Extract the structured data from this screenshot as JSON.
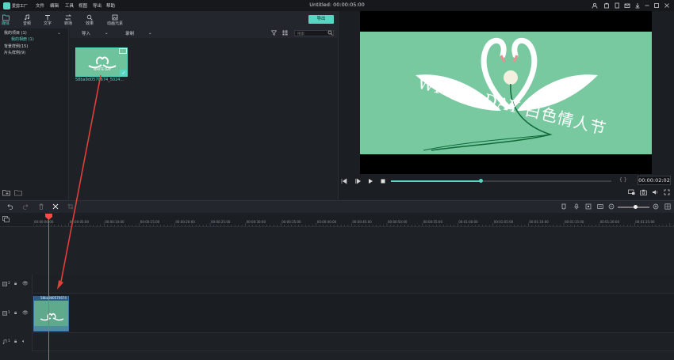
{
  "app": {
    "logo_text": "爱剪工厂",
    "title": "Untitled: 00:00:05:00"
  },
  "menu": [
    "文件",
    "编辑",
    "工具",
    "视图",
    "导出",
    "帮助"
  ],
  "tabs": [
    {
      "label": "媒体",
      "icon": "folder-icon"
    },
    {
      "label": "音频",
      "icon": "music-note-icon"
    },
    {
      "label": "文字",
      "icon": "text-icon"
    },
    {
      "label": "转场",
      "icon": "transition-icon"
    },
    {
      "label": "效果",
      "icon": "effects-icon"
    },
    {
      "label": "动画元素",
      "icon": "image-icon"
    }
  ],
  "export_label": "导出",
  "library": {
    "items": [
      {
        "label": "我的项目 (1)"
      },
      {
        "label": "我的相册 (1)"
      },
      {
        "label": "背景样例(15)"
      },
      {
        "label": "片头样例(9)"
      }
    ],
    "import_label": "导入",
    "record_label": "录制",
    "search_placeholder": "搜索",
    "media": [
      {
        "filename": "58ba9d0570674_5024..."
      }
    ]
  },
  "preview": {
    "timecode": "00:00:02:02",
    "progress": 0.41,
    "bracket_marks": "{ }",
    "frame_text": "WHITE DAY 白色情人节"
  },
  "timeline": {
    "ruler_labels": [
      "00:00:00:00",
      "00:00:05:00",
      "00:00:10:00",
      "00:00:15:00",
      "00:00:20:00",
      "00:00:25:00",
      "00:00:30:00",
      "00:00:35:00",
      "00:00:40:00",
      "00:00:45:00",
      "00:00:50:00",
      "00:00:55:00",
      "00:01:00:00",
      "00:01:05:00",
      "00:01:10:00",
      "00:01:15:00",
      "00:01:20:00",
      "00:01:25:00"
    ],
    "tracks": [
      {
        "number": "2",
        "type": "video"
      },
      {
        "number": "1",
        "type": "video"
      },
      {
        "number": "1",
        "type": "audio"
      }
    ],
    "clip_label": "58ba9d0570674",
    "zoom": 0.55
  },
  "colors": {
    "accent": "#56d6c3",
    "playhead": "#ff4a4a",
    "frame_bg": "#78c8a0",
    "clip_header": "#2c5d86"
  }
}
